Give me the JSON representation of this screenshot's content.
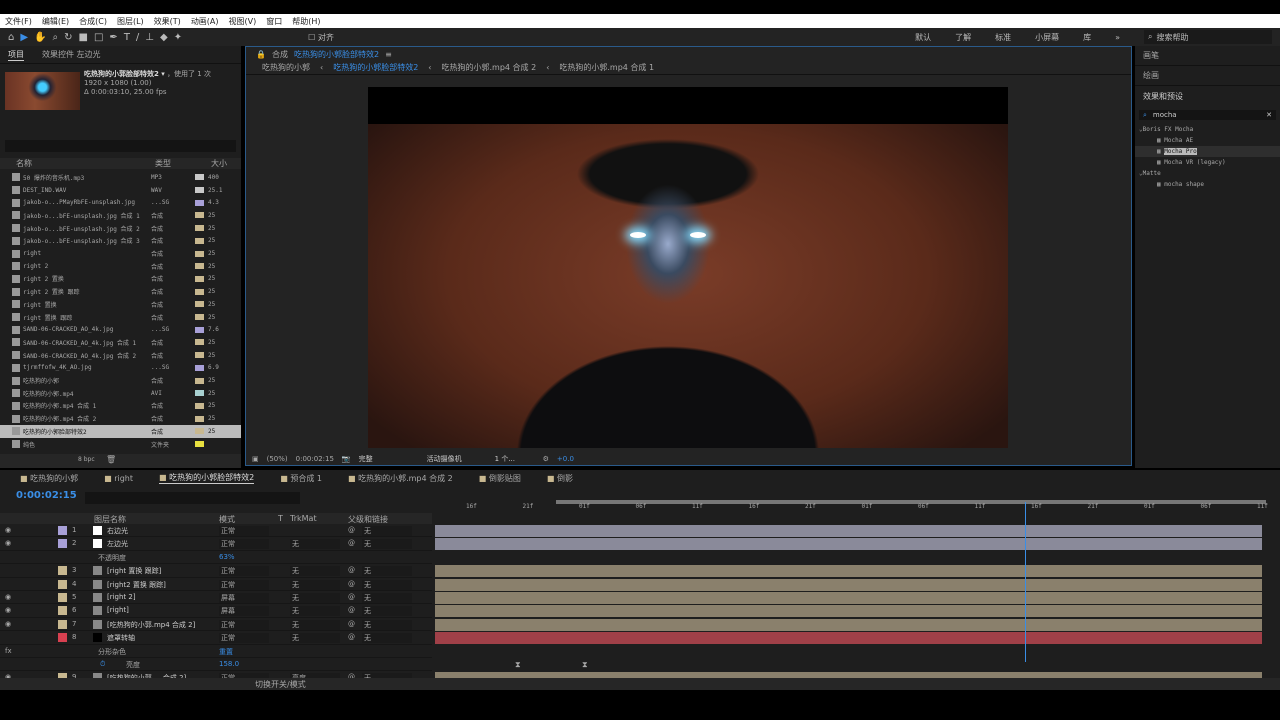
{
  "menu": [
    "文件(F)",
    "编辑(E)",
    "合成(C)",
    "图层(L)",
    "效果(T)",
    "动画(A)",
    "视图(V)",
    "窗口",
    "帮助(H)"
  ],
  "toolbar": {
    "snap_label": "对齐",
    "workspaces": [
      "默认",
      "了解",
      "标准",
      "小屏幕",
      "库"
    ],
    "more": "»",
    "search_help": "搜索帮助"
  },
  "project": {
    "tab_project": "项目",
    "tab_effects": "效果控件 左边光",
    "selected_name": "吃热狗的小郭脸部特效2 ▾",
    "used": "，使用了 1 次",
    "resolution": "1920 x 1080 (1.00)",
    "duration": "Δ 0:00:03:10, 25.00 fps",
    "columns": [
      "名称",
      "类型",
      "大小"
    ],
    "items": [
      {
        "name": "50 爆炸的音乐机.mp3",
        "type": "MP3",
        "size": "400",
        "color": "#c8c8c8"
      },
      {
        "name": "DEST_IND.WAV",
        "type": "WAV",
        "size": "25.1",
        "color": "#c8c8c8"
      },
      {
        "name": "jakob-o...PMayRbFE-unsplash.jpg",
        "type": "...SG",
        "size": "4.3",
        "color": "#a8a0d8"
      },
      {
        "name": "jakob-o...bFE-unsplash.jpg 合成 1",
        "type": "合成",
        "size": "25",
        "color": "#c8b890"
      },
      {
        "name": "jakob-o...bFE-unsplash.jpg 合成 2",
        "type": "合成",
        "size": "25",
        "color": "#c8b890"
      },
      {
        "name": "jakob-o...bFE-unsplash.jpg 合成 3",
        "type": "合成",
        "size": "25",
        "color": "#c8b890"
      },
      {
        "name": "right",
        "type": "合成",
        "size": "25",
        "color": "#c8b890"
      },
      {
        "name": "right 2",
        "type": "合成",
        "size": "25",
        "color": "#c8b890"
      },
      {
        "name": "right 2 置换",
        "type": "合成",
        "size": "25",
        "color": "#c8b890"
      },
      {
        "name": "right 2 置换 跟踪",
        "type": "合成",
        "size": "25",
        "color": "#c8b890"
      },
      {
        "name": "right 置换",
        "type": "合成",
        "size": "25",
        "color": "#c8b890"
      },
      {
        "name": "right 置换 跟踪",
        "type": "合成",
        "size": "25",
        "color": "#c8b890"
      },
      {
        "name": "SAND-06-CRACKED_AO_4k.jpg",
        "type": "...SG",
        "size": "7.6",
        "color": "#a8a0d8"
      },
      {
        "name": "SAND-06-CRACKED_AO_4k.jpg 合成 1",
        "type": "合成",
        "size": "25",
        "color": "#c8b890"
      },
      {
        "name": "SAND-06-CRACKED_AO_4k.jpg 合成 2",
        "type": "合成",
        "size": "25",
        "color": "#c8b890"
      },
      {
        "name": "tjrmffofw_4K_AO.jpg",
        "type": "...SG",
        "size": "6.9",
        "color": "#a8a0d8"
      },
      {
        "name": "吃热狗的小郭",
        "type": "合成",
        "size": "25",
        "color": "#c8b890"
      },
      {
        "name": "吃热狗的小郭.mp4",
        "type": "AVI",
        "size": "25",
        "color": "#a8d0d0"
      },
      {
        "name": "吃热狗的小郭.mp4 合成 1",
        "type": "合成",
        "size": "25",
        "color": "#c8b890"
      },
      {
        "name": "吃热狗的小郭.mp4 合成 2",
        "type": "合成",
        "size": "25",
        "color": "#c8b890"
      },
      {
        "name": "吃热狗的小郭脸部特效2",
        "type": "合成",
        "size": "25",
        "color": "#c8b890",
        "selected": true
      },
      {
        "name": "纯色",
        "type": "文件夹",
        "size": "",
        "color": "#e8e040"
      }
    ],
    "bpc": "8 bpc"
  },
  "viewer": {
    "comp_label": "合成",
    "comp_name": "吃热狗的小郭脸部特效2",
    "breadcrumbs": [
      "吃热狗的小郭",
      "吃热狗的小郭脸部特效2",
      "吃热狗的小郭.mp4 合成 2",
      "吃热狗的小郭.mp4 合成 1"
    ],
    "zoom": "(50%)",
    "timecode": "0:00:02:15",
    "resolution": "完整",
    "camera": "活动摄像机",
    "views": "1 个...",
    "exposure": "+0.0"
  },
  "right_panel": {
    "panels": [
      "画笔",
      "绘画"
    ],
    "effects_title": "效果和预设",
    "search": "mocha",
    "tree": [
      {
        "label": "Boris FX Mocha",
        "group": true
      },
      {
        "label": "Mocha AE"
      },
      {
        "label": "Mocha Pro",
        "selected": true
      },
      {
        "label": "Mocha VR (legacy)"
      },
      {
        "label": "Matte",
        "group": true
      },
      {
        "label": "mocha shape"
      }
    ]
  },
  "timeline": {
    "tabs": [
      "吃热狗的小郭",
      "right",
      "吃热狗的小郭脸部特效2",
      "预合成 1",
      "吃热狗的小郭.mp4 合成 2",
      "倒影贴图",
      "倒影"
    ],
    "active_tab": 2,
    "timecode": "0:00:02:15",
    "columns": {
      "name": "图层名称",
      "mode": "模式",
      "t": "T",
      "trkmat": "TrkMat",
      "parent": "父级和链接"
    },
    "ruler": [
      "16f",
      "21f",
      "01f",
      "06f",
      "11f",
      "16f",
      "21f",
      "01f",
      "06f",
      "11f",
      "16f",
      "21f",
      "01f",
      "06f",
      "11f"
    ],
    "layers": [
      {
        "num": "1",
        "name": "右边光",
        "mode": "正常",
        "trkmat": "",
        "parent": "无",
        "label": "#a8a0d8",
        "visible": true,
        "bar": "#8a8a9a"
      },
      {
        "num": "2",
        "name": "左边光",
        "mode": "正常",
        "trkmat": "无",
        "parent": "无",
        "label": "#a8a0d8",
        "visible": true,
        "bar": "#8a8a9a"
      },
      {
        "prop": "不透明度",
        "value": "63%"
      },
      {
        "num": "3",
        "name": "[right 置换 跟踪]",
        "mode": "正常",
        "trkmat": "无",
        "parent": "无",
        "label": "#c8b890",
        "visible": false,
        "bar": "#8a806c"
      },
      {
        "num": "4",
        "name": "[right2 置换 跟踪]",
        "mode": "正常",
        "trkmat": "无",
        "parent": "无",
        "label": "#c8b890",
        "visible": false,
        "bar": "#8a806c"
      },
      {
        "num": "5",
        "name": "[right 2]",
        "mode": "屏幕",
        "trkmat": "无",
        "parent": "无",
        "label": "#c8b890",
        "visible": true,
        "bar": "#8a806c"
      },
      {
        "num": "6",
        "name": "[right]",
        "mode": "屏幕",
        "trkmat": "无",
        "parent": "无",
        "label": "#c8b890",
        "visible": true,
        "bar": "#8a806c"
      },
      {
        "num": "7",
        "name": "[吃热狗的小郭.mp4 合成 2]",
        "mode": "正常",
        "trkmat": "无",
        "parent": "无",
        "label": "#c8b890",
        "visible": true,
        "bar": "#8a806c"
      },
      {
        "num": "8",
        "name": "遮罩转轴",
        "mode": "正常",
        "trkmat": "无",
        "parent": "无",
        "label": "#d84050",
        "visible": false,
        "bar": "#a04048"
      },
      {
        "prop": "分形杂色",
        "value": "重置",
        "fx": true
      },
      {
        "prop": "亮度",
        "value": "158.0",
        "keyed": true
      },
      {
        "num": "9",
        "name": "[吃热狗的小郭 ... 合成 2]",
        "mode": "正常",
        "trkmat": "亮度",
        "parent": "无",
        "label": "#c8b890",
        "visible": true,
        "bar": "#8a806c"
      }
    ],
    "footer": "切换开关/模式"
  },
  "colors": {
    "accent": "#3a8ee6",
    "panel": "#1e1e1e"
  }
}
